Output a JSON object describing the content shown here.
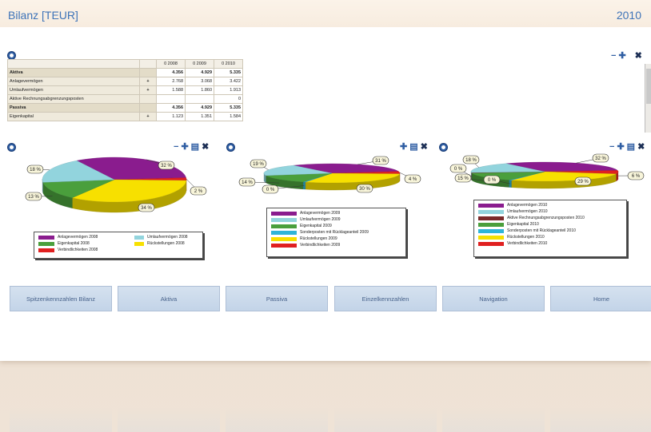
{
  "header": {
    "title": "Bilanz [TEUR]",
    "year": "2010"
  },
  "table": {
    "columns": [
      "0 2008",
      "0 2009",
      "0 2010"
    ],
    "rows": [
      {
        "label": "Aktiva",
        "plus": "",
        "values": [
          "4.356",
          "4.929",
          "5.335"
        ],
        "bold": true
      },
      {
        "label": "Anlagevermögen",
        "plus": "+",
        "values": [
          "2.768",
          "3.068",
          "3.422"
        ],
        "bold": false
      },
      {
        "label": "Umlaufvermögen",
        "plus": "+",
        "values": [
          "1.588",
          "1.860",
          "1.913"
        ],
        "bold": false
      },
      {
        "label": "Aktive Rechnungsabgrenzungsposten",
        "plus": "",
        "values": [
          "",
          "",
          "0"
        ],
        "bold": false
      },
      {
        "label": "Passiva",
        "plus": "",
        "values": [
          "4.356",
          "4.929",
          "5.335"
        ],
        "bold": true
      },
      {
        "label": "Eigenkapital",
        "plus": "+",
        "values": [
          "1.123",
          "1.351",
          "1.584"
        ],
        "bold": false
      }
    ]
  },
  "colors": {
    "purple": "#8a1c8e",
    "cyan": "#92d4dd",
    "green": "#4a9f3c",
    "red": "#e02020",
    "yellow": "#f7e000",
    "teal": "#2fb5d8",
    "accent": "#3d73b8"
  },
  "chart_data": [
    {
      "type": "pie",
      "slices": [
        {
          "label": "32 %",
          "value": 32,
          "color": "#8a1c8e"
        },
        {
          "label": "2 %",
          "value": 2,
          "color": "#e02020"
        },
        {
          "label": "34 %",
          "value": 34,
          "color": "#f7e000"
        },
        {
          "label": "13 %",
          "value": 13,
          "color": "#4a9f3c"
        },
        {
          "label": "18 %",
          "value": 18,
          "color": "#92d4dd"
        }
      ],
      "legend": [
        {
          "label": "Anlagevermögen 2008",
          "color": "#8a1c8e"
        },
        {
          "label": "Umlaufvermögen 2008",
          "color": "#92d4dd"
        },
        {
          "label": "Eigenkapital 2008",
          "color": "#4a9f3c"
        },
        {
          "label": "Rückstellungen 2008",
          "color": "#f7e000"
        },
        {
          "label": "Verbindlichkeiten 2008",
          "color": "#e02020"
        }
      ]
    },
    {
      "type": "pie",
      "slices": [
        {
          "label": "31 %",
          "value": 31,
          "color": "#8a1c8e"
        },
        {
          "label": "4 %",
          "value": 4,
          "color": "#e02020"
        },
        {
          "label": "30 %",
          "value": 30,
          "color": "#f7e000"
        },
        {
          "label": "0 %",
          "value": 0.6,
          "color": "#2fb5d8"
        },
        {
          "label": "14 %",
          "value": 14,
          "color": "#4a9f3c"
        },
        {
          "label": "19 %",
          "value": 19,
          "color": "#92d4dd"
        }
      ],
      "legend": [
        {
          "label": "Anlagevermögen 2009",
          "color": "#8a1c8e"
        },
        {
          "label": "Umlaufvermögen 2009",
          "color": "#92d4dd"
        },
        {
          "label": "Eigenkapital 2009",
          "color": "#4a9f3c"
        },
        {
          "label": "Sonderposten mit Rücklageanteil 2009",
          "color": "#2fb5d8"
        },
        {
          "label": "Rückstellungen 2009",
          "color": "#f7e000"
        },
        {
          "label": "Verbindlichkeiten 2009",
          "color": "#e02020"
        }
      ]
    },
    {
      "type": "pie",
      "slices": [
        {
          "label": "32 %",
          "value": 32,
          "color": "#8a1c8e"
        },
        {
          "label": "6 %",
          "value": 6,
          "color": "#e02020"
        },
        {
          "label": "29 %",
          "value": 29,
          "color": "#f7e000"
        },
        {
          "label": "0 %",
          "value": 0.6,
          "color": "#2fb5d8"
        },
        {
          "label": "15 %",
          "value": 15,
          "color": "#4a9f3c"
        },
        {
          "label": "0 %",
          "value": 0.6,
          "color": "#7a2a2a"
        },
        {
          "label": "18 %",
          "value": 18,
          "color": "#92d4dd"
        }
      ],
      "legend": [
        {
          "label": "Anlagevermögen 2010",
          "color": "#8a1c8e"
        },
        {
          "label": "Umlaufvermögen 2010",
          "color": "#92d4dd"
        },
        {
          "label": "Aktive Rechnungsabgrenzungsposten 2010",
          "color": "#7a2a2a"
        },
        {
          "label": "Eigenkapital 2010",
          "color": "#4a9f3c"
        },
        {
          "label": "Sonderposten mit Rücklageanteil 2010",
          "color": "#2fb5d8"
        },
        {
          "label": "Rückstellungen 2010",
          "color": "#f7e000"
        },
        {
          "label": "Verbindlichkeiten 2010",
          "color": "#e02020"
        }
      ]
    }
  ],
  "nav": [
    "Spitzenkennzahlen Bilanz",
    "Aktiva",
    "Passiva",
    "Einzelkennzahlen",
    "Navigation",
    "Home"
  ],
  "icons": {
    "settings": "gear-icon",
    "minimize": "minimize-icon",
    "add": "add-icon",
    "table": "table-view-icon",
    "close": "close-icon"
  }
}
